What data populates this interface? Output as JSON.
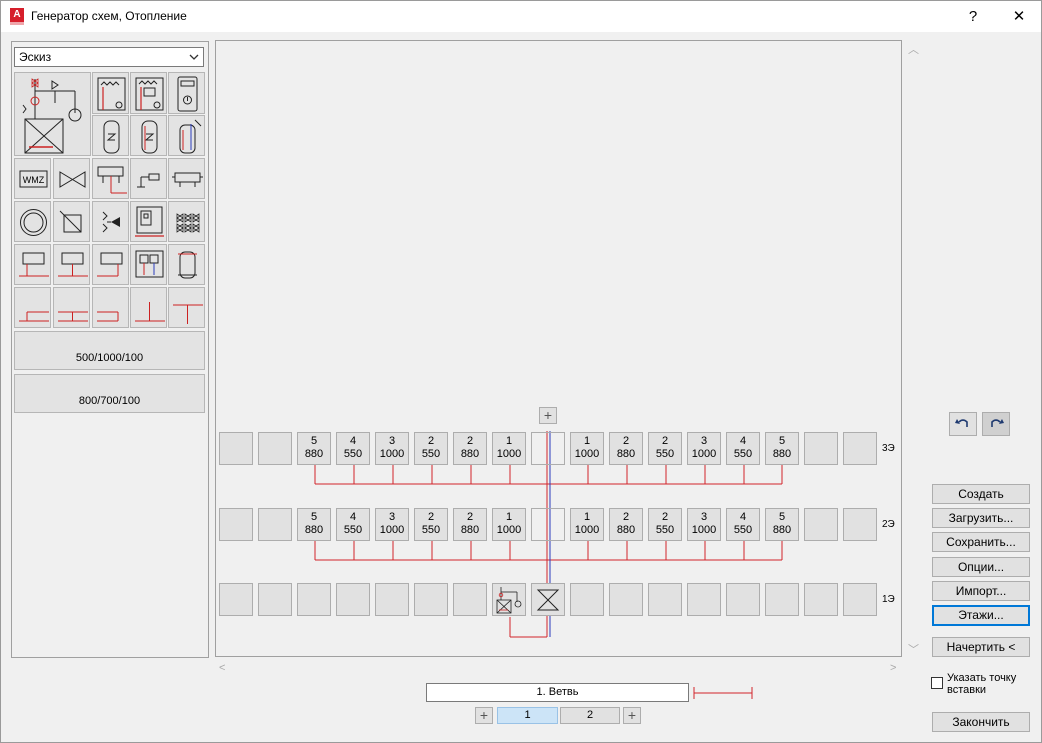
{
  "window": {
    "title": "Генератор схем, Отопление",
    "help_label": "?",
    "close_label": "✕"
  },
  "palette": {
    "mode_selected": "Эскиз",
    "wide_items": [
      {
        "label": "500/1000/100"
      },
      {
        "label": "800/700/100"
      }
    ]
  },
  "canvas": {
    "floors": [
      {
        "label": "3Э"
      },
      {
        "label": "2Э"
      },
      {
        "label": "1Э"
      }
    ],
    "cells": [
      {
        "top": "5",
        "bottom": "880"
      },
      {
        "top": "4",
        "bottom": "550"
      },
      {
        "top": "3",
        "bottom": "1000"
      },
      {
        "top": "2",
        "bottom": "550"
      },
      {
        "top": "2",
        "bottom": "880"
      },
      {
        "top": "1",
        "bottom": "1000"
      },
      {
        "top": "",
        "bottom": ""
      },
      {
        "top": "1",
        "bottom": "1000"
      },
      {
        "top": "2",
        "bottom": "880"
      },
      {
        "top": "2",
        "bottom": "550"
      },
      {
        "top": "3",
        "bottom": "1000"
      },
      {
        "top": "4",
        "bottom": "550"
      },
      {
        "top": "5",
        "bottom": "880"
      }
    ]
  },
  "actions": {
    "create": "Создать",
    "load": "Загрузить...",
    "save": "Сохранить...",
    "options": "Опции...",
    "import": "Импорт...",
    "floors": "Этажи...",
    "draw": "Начертить <",
    "finish": "Закончить"
  },
  "insert_point": {
    "label": "Указать точку вставки",
    "checked": false
  },
  "branch": {
    "name": "1. Ветвь",
    "tabs": [
      {
        "label": "1",
        "active": true
      },
      {
        "label": "2",
        "active": false
      }
    ],
    "add_label": "+"
  },
  "icons": {
    "undo": "undo-icon",
    "redo": "redo-icon",
    "add": "plus-icon",
    "dropdown": "chevron-down-icon"
  },
  "colors": {
    "accent": "#0078d7",
    "pipe_red": "#d2232a",
    "pipe_blue": "#2b3dbd",
    "app_red": "#d61f2b"
  }
}
